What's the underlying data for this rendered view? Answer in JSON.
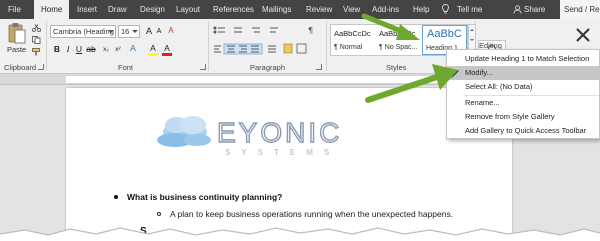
{
  "ribbon_tabs": [
    {
      "label": "File",
      "active": false
    },
    {
      "label": "Home",
      "active": true
    },
    {
      "label": "Insert",
      "active": false
    },
    {
      "label": "Draw",
      "active": false
    },
    {
      "label": "Design",
      "active": false
    },
    {
      "label": "Layout",
      "active": false
    },
    {
      "label": "References",
      "active": false
    },
    {
      "label": "Mailings",
      "active": false
    },
    {
      "label": "Review",
      "active": false
    },
    {
      "label": "View",
      "active": false
    },
    {
      "label": "Add-ins",
      "active": false
    },
    {
      "label": "Help",
      "active": false
    }
  ],
  "tell_me": "Tell me",
  "share": "Share",
  "send_receive": "Send / Rece",
  "clipboard": {
    "paste_label": "Paste",
    "group_label": "Clipboard"
  },
  "font": {
    "font_name": "Cambria (Heading",
    "font_size": "16",
    "group_label": "Font",
    "bold": "B",
    "italic": "I",
    "underline": "U",
    "font_color_glyph": "A",
    "highlight_glyph": "A"
  },
  "paragraph": {
    "group_label": "Paragraph"
  },
  "styles": {
    "group_label": "Styles",
    "cards": [
      {
        "preview": "AaBbCcDc",
        "name": "¶ Normal",
        "selected": false
      },
      {
        "preview": "AaBbCcDc",
        "name": "¶ No Spac...",
        "selected": false
      },
      {
        "preview": "AaBbC",
        "name": "Heading 1",
        "selected": true
      }
    ]
  },
  "editing": {
    "label": "Editing"
  },
  "context_menu": {
    "items": [
      {
        "label": "Update Heading 1 to Match Selection",
        "highlighted": false
      },
      {
        "label": "Modify...",
        "highlighted": true
      },
      {
        "label": "Select All: (No Data)",
        "highlighted": false
      },
      {
        "label": "Rename...",
        "highlighted": false
      },
      {
        "label": "Remove from Style Gallery",
        "highlighted": false
      },
      {
        "label": "Add Gallery to Quick Access Toolbar",
        "highlighted": false
      }
    ]
  },
  "document": {
    "logo_text": "EYONIC",
    "logo_subtext": "SYSTEMS",
    "heading_bullet": "What is business continuity planning?",
    "sub_bullet": "A plan to keep business operations running when the unexpected happens.",
    "trailing_char": "S"
  },
  "colors": {
    "accent_blue": "#2e74b5",
    "arrow_green": "#6ea82f",
    "tabbar": "#444444",
    "logo_gray": "#8a9ab0",
    "cloud_blue": "#9cc7ea"
  }
}
